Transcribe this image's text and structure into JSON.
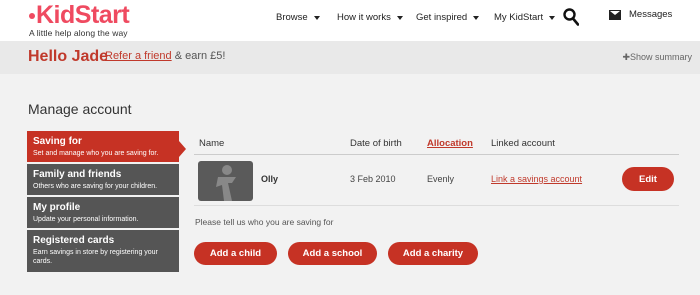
{
  "header": {
    "logo_text": "KidStart",
    "tagline": "A little help along the way",
    "nav": [
      {
        "label": "Browse"
      },
      {
        "label": "How it works"
      },
      {
        "label": "Get inspired"
      },
      {
        "label": "My KidStart"
      }
    ],
    "messages_label": "Messages"
  },
  "hello": {
    "greeting": "Hello Jade",
    "refer_link": "Refer a friend",
    "refer_suffix": " & earn £5!",
    "summary_toggle": "Show summary"
  },
  "page_title": "Manage account",
  "sidebar": {
    "items": [
      {
        "title": "Saving for",
        "subtitle": "Set and manage who you are saving for.",
        "active": true
      },
      {
        "title": "Family and friends",
        "subtitle": "Others who are saving for your children."
      },
      {
        "title": "My profile",
        "subtitle": "Update your personal information."
      },
      {
        "title": "Registered cards",
        "subtitle": "Earn savings in store by registering your cards."
      }
    ]
  },
  "table": {
    "columns": [
      "Name",
      "Date of birth",
      "Allocation",
      "Linked account"
    ],
    "rows": [
      {
        "name": "Olly",
        "dob": "3 Feb 2010",
        "allocation": "Evenly",
        "linked": "Link a savings account",
        "edit_label": "Edit"
      }
    ]
  },
  "prompt": "Please tell us who you are saving for",
  "actions": {
    "add_child": "Add a child",
    "add_school": "Add a school",
    "add_charity": "Add a charity"
  },
  "colors": {
    "brand": "#ef4a60",
    "accent": "#c63224",
    "sidebar": "#555555"
  }
}
